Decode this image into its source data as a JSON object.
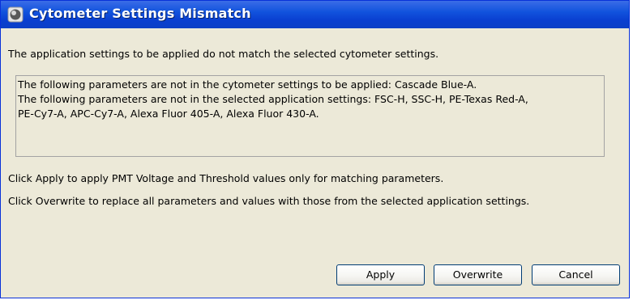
{
  "dialog": {
    "title": "Cytometer Settings Mismatch",
    "icon": "app-window-icon",
    "message": "The application settings to be applied do not match the selected cytometer settings.",
    "details": [
      "The following parameters are not in the cytometer settings to be applied: Cascade Blue-A.",
      "The following parameters are not in the selected application settings: FSC-H, SSC-H, PE-Texas Red-A,",
      "PE-Cy7-A, APC-Cy7-A, Alexa Fluor 405-A, Alexa Fluor 430-A."
    ],
    "apply_hint": "Click Apply to apply PMT Voltage and Threshold values only for matching parameters.",
    "overwrite_hint": "Click Overwrite to replace all parameters and values with those from the selected application settings."
  },
  "buttons": {
    "apply": "Apply",
    "overwrite": "Overwrite",
    "cancel": "Cancel"
  },
  "colors": {
    "titlebar": "#0a3fd1",
    "dialog_background": "#ece9d8",
    "button_border": "#003c74"
  }
}
